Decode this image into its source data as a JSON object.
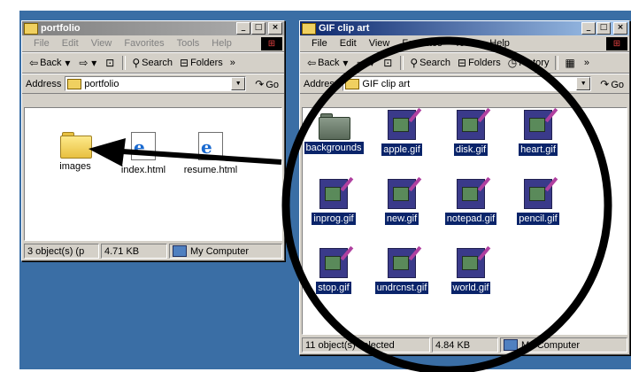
{
  "left_window": {
    "title": "portfolio",
    "menu": [
      "File",
      "Edit",
      "View",
      "Favorites",
      "Tools",
      "Help"
    ],
    "toolbar": {
      "back": "Back",
      "search": "Search",
      "folders": "Folders",
      "more": "»"
    },
    "address": {
      "label": "Address",
      "value": "portfolio",
      "go": "Go"
    },
    "items": [
      {
        "label": "images",
        "icon": "folder-icon"
      },
      {
        "label": "index.html",
        "icon": "ie-html-icon"
      },
      {
        "label": "resume.html",
        "icon": "ie-html-icon"
      }
    ],
    "status": {
      "count": "3 object(s) (p",
      "size": "4.71 KB",
      "zone": "My Computer"
    }
  },
  "right_window": {
    "title": "GIF clip art",
    "menu": [
      "File",
      "Edit",
      "View",
      "Favorites",
      "Tools",
      "Help"
    ],
    "toolbar": {
      "back": "Back",
      "search": "Search",
      "folders": "Folders",
      "history": "History",
      "more": "»"
    },
    "address": {
      "label": "Address",
      "value": "GIF clip art",
      "go": "Go"
    },
    "items": [
      {
        "label": "backgrounds",
        "icon": "folder-icon"
      },
      {
        "label": "apple.gif",
        "icon": "gif-icon"
      },
      {
        "label": "disk.gif",
        "icon": "gif-icon"
      },
      {
        "label": "heart.gif",
        "icon": "gif-icon"
      },
      {
        "label": "inprog.gif",
        "icon": "gif-icon"
      },
      {
        "label": "new.gif",
        "icon": "gif-icon"
      },
      {
        "label": "notepad.gif",
        "icon": "gif-icon"
      },
      {
        "label": "pencil.gif",
        "icon": "gif-icon"
      },
      {
        "label": "stop.gif",
        "icon": "gif-icon"
      },
      {
        "label": "undrcnst.gif",
        "icon": "gif-icon"
      },
      {
        "label": "world.gif",
        "icon": "gif-icon"
      }
    ],
    "status": {
      "count": "11 object(s) selected",
      "size": "4.84 KB",
      "zone": "My Computer"
    }
  },
  "colors": {
    "desktop": "#3a6ea5",
    "active_title": "#0a246a",
    "inactive_title": "#808080",
    "highlight": "#0a246a"
  }
}
